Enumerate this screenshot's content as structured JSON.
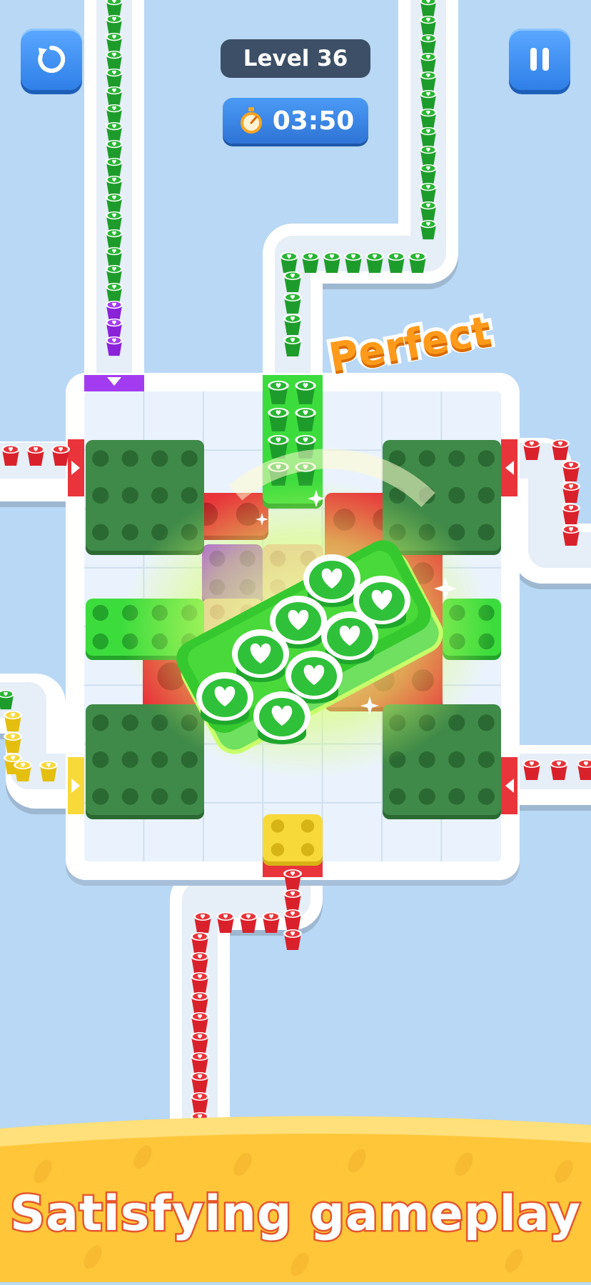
{
  "hud": {
    "level_label": "Level 36",
    "timer": "03:50",
    "restart_icon": "restart-icon",
    "pause_icon": "pause-icon",
    "stopwatch_icon": "stopwatch-icon"
  },
  "feedback": {
    "perfect_text": "Perfect"
  },
  "promo": {
    "tagline": "Satisfying gameplay"
  },
  "colors": {
    "background": "#b9d8f5",
    "board": "#eaf3fd",
    "dark_green": "#3f8a48",
    "red": "#e8343a",
    "green": "#3ddc3d",
    "purple": "#a33cf0",
    "pink": "#f7a8c4",
    "yellow": "#f8d93a",
    "banner": "#ffc63a"
  }
}
